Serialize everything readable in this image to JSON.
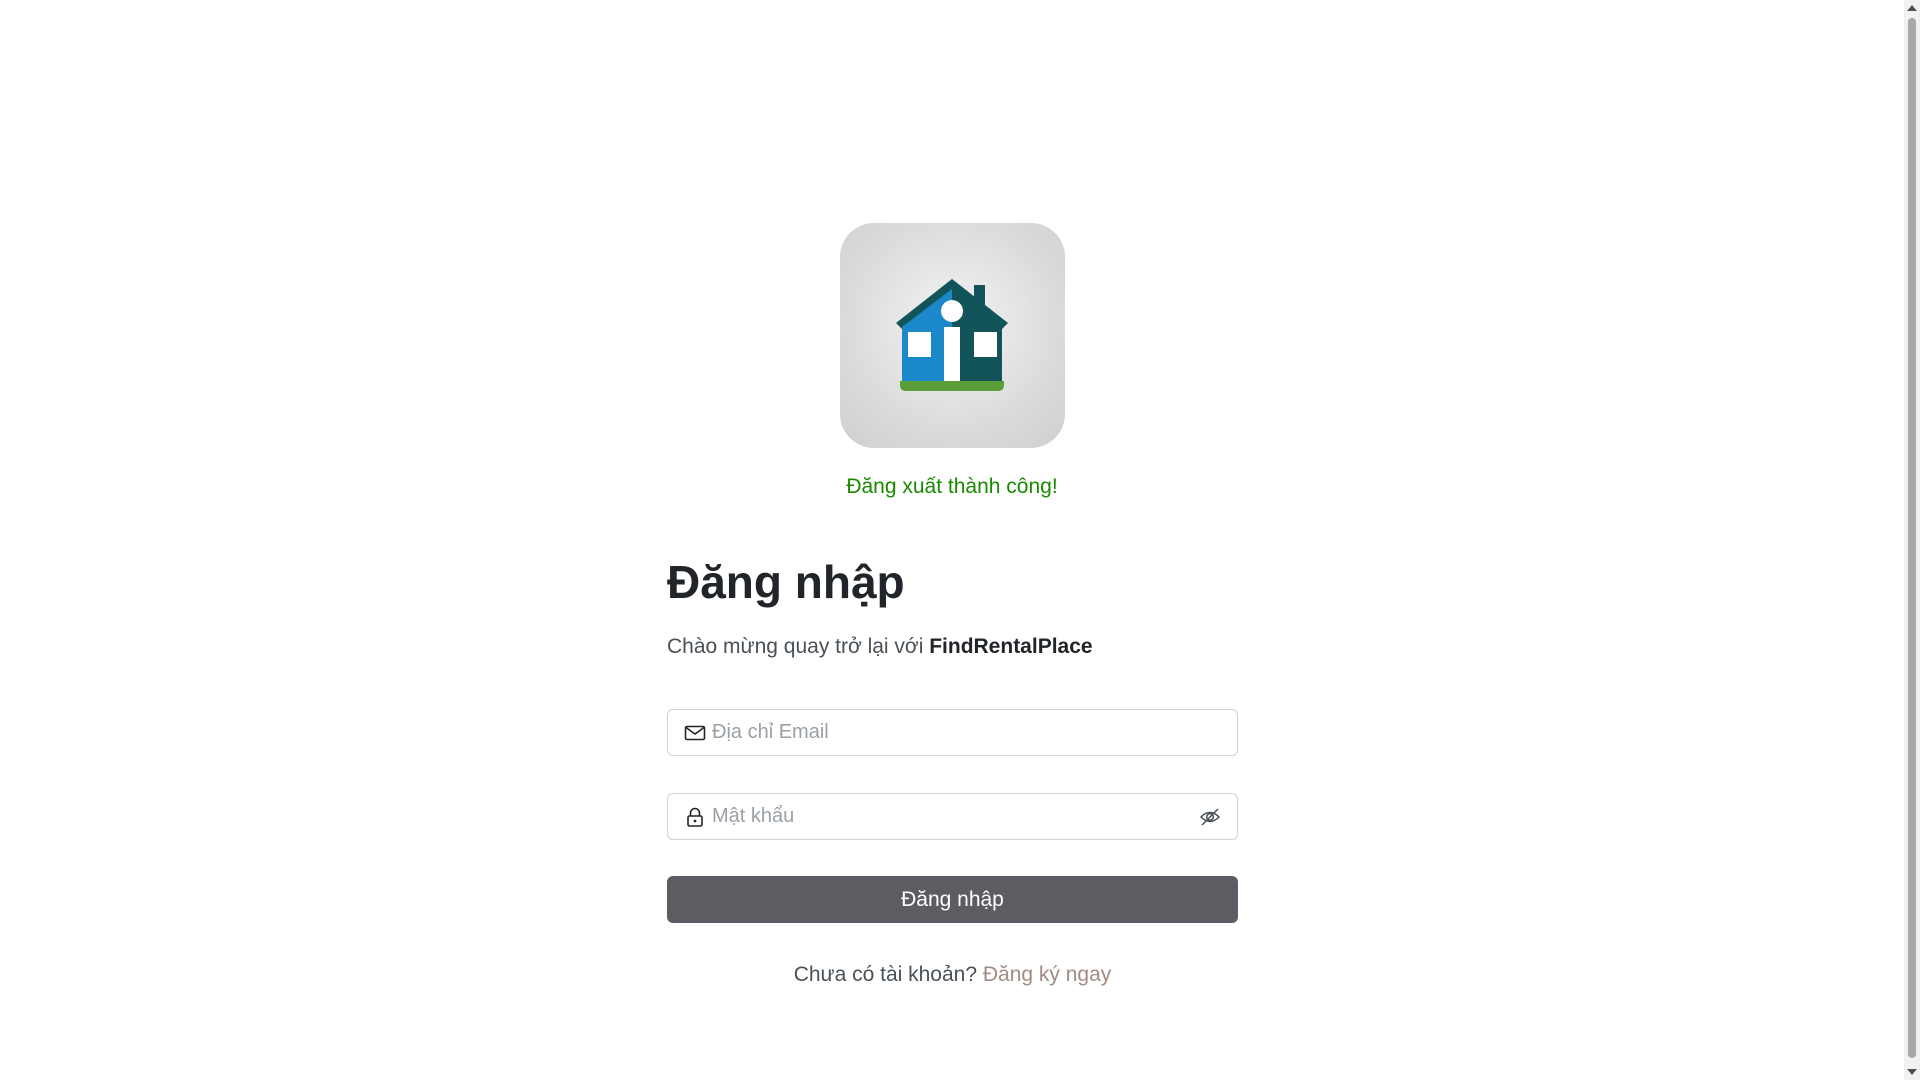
{
  "logo": {
    "icon": "house-icon",
    "colors": {
      "roof_left": "#1a88c9",
      "roof_right": "#13545a",
      "ground": "#5c9e3a"
    }
  },
  "flash": {
    "message": "Đăng xuất thành công!",
    "color": "#198a00"
  },
  "login": {
    "title": "Đăng nhập",
    "subtitle_prefix": "Chào mừng quay trở lại với ",
    "brand": "FindRentalPlace",
    "email": {
      "placeholder": "Địa chỉ Email",
      "value": "",
      "icon": "envelope-icon"
    },
    "password": {
      "placeholder": "Mật khẩu",
      "value": "",
      "icon": "lock-icon",
      "toggle_icon": "eye-slash-icon"
    },
    "submit_label": "Đăng nhập",
    "submit_color": "#5c5c63",
    "register_prompt": "Chưa có tài khoản?",
    "register_link": "Đăng ký ngay"
  }
}
